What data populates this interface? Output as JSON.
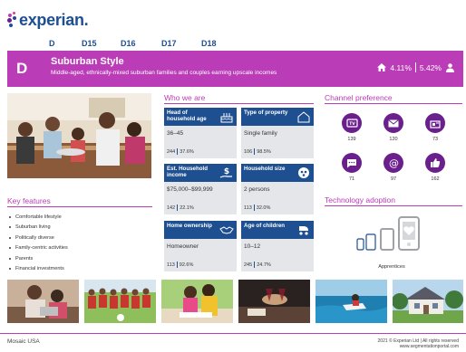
{
  "brand": {
    "name": "experian.",
    "color": "#1d4f91",
    "dot_colors": [
      "#bb3cb7",
      "#e63888",
      "#6a1f8d",
      "#26478d",
      "#1d4f91"
    ]
  },
  "nav": [
    {
      "label": "D"
    },
    {
      "label": "D15"
    },
    {
      "label": "D16"
    },
    {
      "label": "D17"
    },
    {
      "label": "D18"
    }
  ],
  "banner": {
    "letter": "D",
    "title": "Suburban Style",
    "subtitle": "Middle-aged, ethnically-mixed suburban families and couples earning upscale incomes",
    "household_pct": "4.11%",
    "population_pct": "5.42%",
    "color": "#bb3cb7"
  },
  "sections": {
    "who": "Who we are",
    "features": "Key features",
    "channel": "Channel preference",
    "tech": "Technology adoption"
  },
  "cards": [
    {
      "label": "Head of household age",
      "value": "36–45",
      "index": "244",
      "pct": "37.6%",
      "icon": "cake-icon"
    },
    {
      "label": "Type of property",
      "value": "Single family",
      "index": "106",
      "pct": "98.5%",
      "icon": "house-icon"
    },
    {
      "label": "Est. Household income",
      "value": "$75,000–$99,999",
      "index": "142",
      "pct": "22.1%",
      "icon": "money-hand-icon"
    },
    {
      "label": "Household size",
      "value": "2 persons",
      "index": "113",
      "pct": "32.0%",
      "icon": "people-circle-icon"
    },
    {
      "label": "Home ownership",
      "value": "Homeowner",
      "index": "113",
      "pct": "92.6%",
      "icon": "handshake-icon"
    },
    {
      "label": "Age of children",
      "value": "10–12",
      "index": "245",
      "pct": "24.7%",
      "icon": "stroller-icon"
    }
  ],
  "features": [
    "Comfortable lifestyle",
    "Suburban living",
    "Politically diverse",
    "Family-centric activities",
    "Parents",
    "Financial investments"
  ],
  "channels": [
    {
      "icon": "tv-icon",
      "value": "139"
    },
    {
      "icon": "email-icon",
      "value": "120"
    },
    {
      "icon": "mail-icon",
      "value": "73"
    },
    {
      "icon": "sms-icon",
      "value": "71"
    },
    {
      "icon": "at-sign-icon",
      "value": "97"
    },
    {
      "icon": "social-like-icon",
      "value": "162"
    }
  ],
  "channel_color": "#6a1f8d",
  "tech": {
    "label": "Apprentices"
  },
  "footer": {
    "left": "Mosaic USA",
    "right_line1": "2021 © Experian Ltd | All rights reserved",
    "right_line2": "www.segmentationportal.com"
  }
}
